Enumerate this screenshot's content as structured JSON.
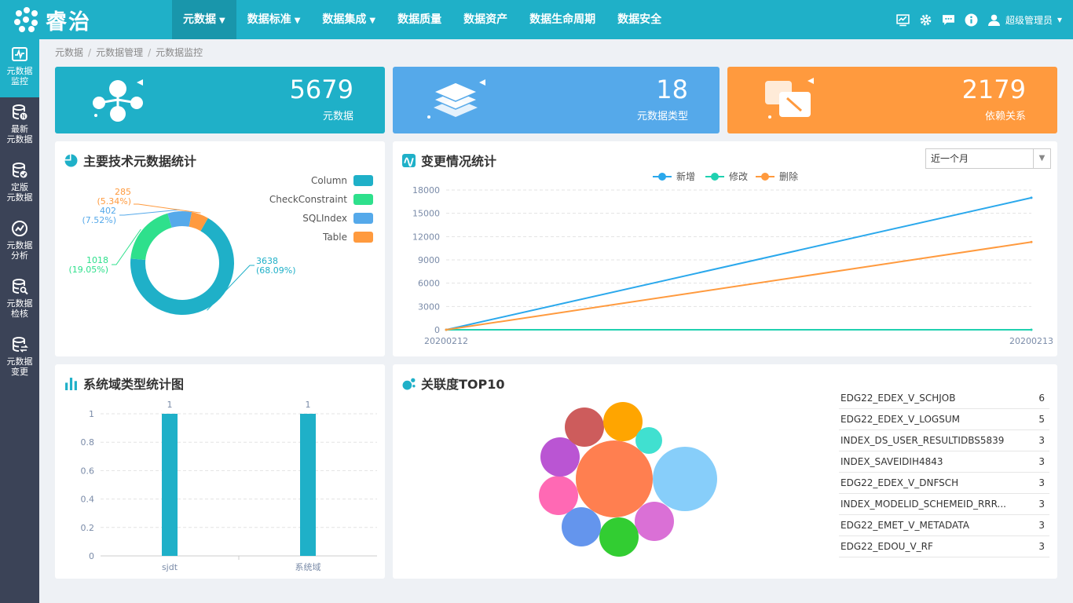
{
  "app": {
    "logo_text": "睿治"
  },
  "nav": [
    {
      "label": "元数据",
      "dropdown": true,
      "active": true
    },
    {
      "label": "数据标准",
      "dropdown": true
    },
    {
      "label": "数据集成",
      "dropdown": true
    },
    {
      "label": "数据质量",
      "dropdown": false
    },
    {
      "label": "数据资产",
      "dropdown": false
    },
    {
      "label": "数据生命周期",
      "dropdown": false
    },
    {
      "label": "数据安全",
      "dropdown": false
    }
  ],
  "header": {
    "user_name": "超级管理员",
    "user_caret": "▾",
    "caret": "▾"
  },
  "sidebar": [
    {
      "l1": "元数据",
      "l2": "监控",
      "icon": "monitor-icon",
      "active": true
    },
    {
      "l1": "最新",
      "l2": "元数据",
      "icon": "database-new-icon"
    },
    {
      "l1": "定版",
      "l2": "元数据",
      "icon": "database-check-icon"
    },
    {
      "l1": "元数据",
      "l2": "分析",
      "icon": "analysis-icon"
    },
    {
      "l1": "元数据",
      "l2": "检核",
      "icon": "database-search-icon"
    },
    {
      "l1": "元数据",
      "l2": "变更",
      "icon": "database-change-icon"
    }
  ],
  "breadcrumb": [
    "元数据",
    "元数据管理",
    "元数据监控"
  ],
  "stats": [
    {
      "value": "5679",
      "label": "元数据",
      "color": "#1fb0c8"
    },
    {
      "value": "18",
      "label": "元数据类型",
      "color": "#55a9ea"
    },
    {
      "value": "2179",
      "label": "依赖关系",
      "color": "#ff9a3e"
    }
  ],
  "panels": {
    "tech": {
      "title": "主要技术元数据统计"
    },
    "change": {
      "title": "变更情况统计",
      "select_value": "近一个月",
      "select_arrow": "▼"
    },
    "domain": {
      "title": "系统域类型统计图"
    },
    "top": {
      "title": "关联度TOP10"
    }
  },
  "chart_data": [
    {
      "type": "pie",
      "donut": true,
      "categories": [
        "Column",
        "CheckConstraint",
        "SQLIndex",
        "Table"
      ],
      "values": [
        3638,
        1018,
        402,
        285
      ],
      "percent_labels": [
        "(68.09%)",
        "(19.05%)",
        "(7.52%)",
        "(5.34%)"
      ],
      "colors": [
        "#1fb0c8",
        "#2ee08c",
        "#55a9ea",
        "#ff9a3e"
      ],
      "legend": "top-right"
    },
    {
      "type": "line",
      "x": [
        "20200212",
        "20200213"
      ],
      "series": [
        {
          "name": "新增",
          "values": [
            0,
            17000
          ],
          "color": "#2aa8ec"
        },
        {
          "name": "修改",
          "values": [
            0,
            0
          ],
          "color": "#1fd1b0"
        },
        {
          "name": "删除",
          "values": [
            0,
            11300
          ],
          "color": "#ff9a3e"
        }
      ],
      "yticks": [
        "0",
        "3000",
        "6000",
        "9000",
        "12000",
        "15000",
        "18000"
      ],
      "ylim": [
        0,
        18000
      ],
      "grid": true,
      "legend": "top-center"
    },
    {
      "type": "bar",
      "categories": [
        "sjdt",
        "系统域"
      ],
      "values": [
        1,
        1
      ],
      "value_labels": [
        "1",
        "1"
      ],
      "yticks": [
        "0",
        "0.2",
        "0.4",
        "0.6",
        "0.8",
        "1"
      ],
      "ylim": [
        0,
        1
      ],
      "color": "#1fb0c8",
      "grid": true
    },
    {
      "type": "bubble",
      "colors": [
        "#ff7f50",
        "#87cefa",
        "#da70d6",
        "#32cd32",
        "#6495ed",
        "#ff69b4",
        "#ba55d3",
        "#cd5c5c",
        "#ffa500",
        "#40e0d0"
      ]
    }
  ],
  "top10": [
    {
      "name": "EDG22_EDEX_V_SCHJOB",
      "count": "6"
    },
    {
      "name": "EDG22_EDEX_V_LOGSUM",
      "count": "5"
    },
    {
      "name": "INDEX_DS_USER_RESULTIDBS5839",
      "count": "3"
    },
    {
      "name": "INDEX_SAVEIDIH4843",
      "count": "3"
    },
    {
      "name": "EDG22_EDEX_V_DNFSCH",
      "count": "3"
    },
    {
      "name": "INDEX_MODELID_SCHEMEID_RRR...",
      "count": "3"
    },
    {
      "name": "EDG22_EMET_V_METADATA",
      "count": "3"
    },
    {
      "name": "EDG22_EDOU_V_RF",
      "count": "3"
    }
  ]
}
